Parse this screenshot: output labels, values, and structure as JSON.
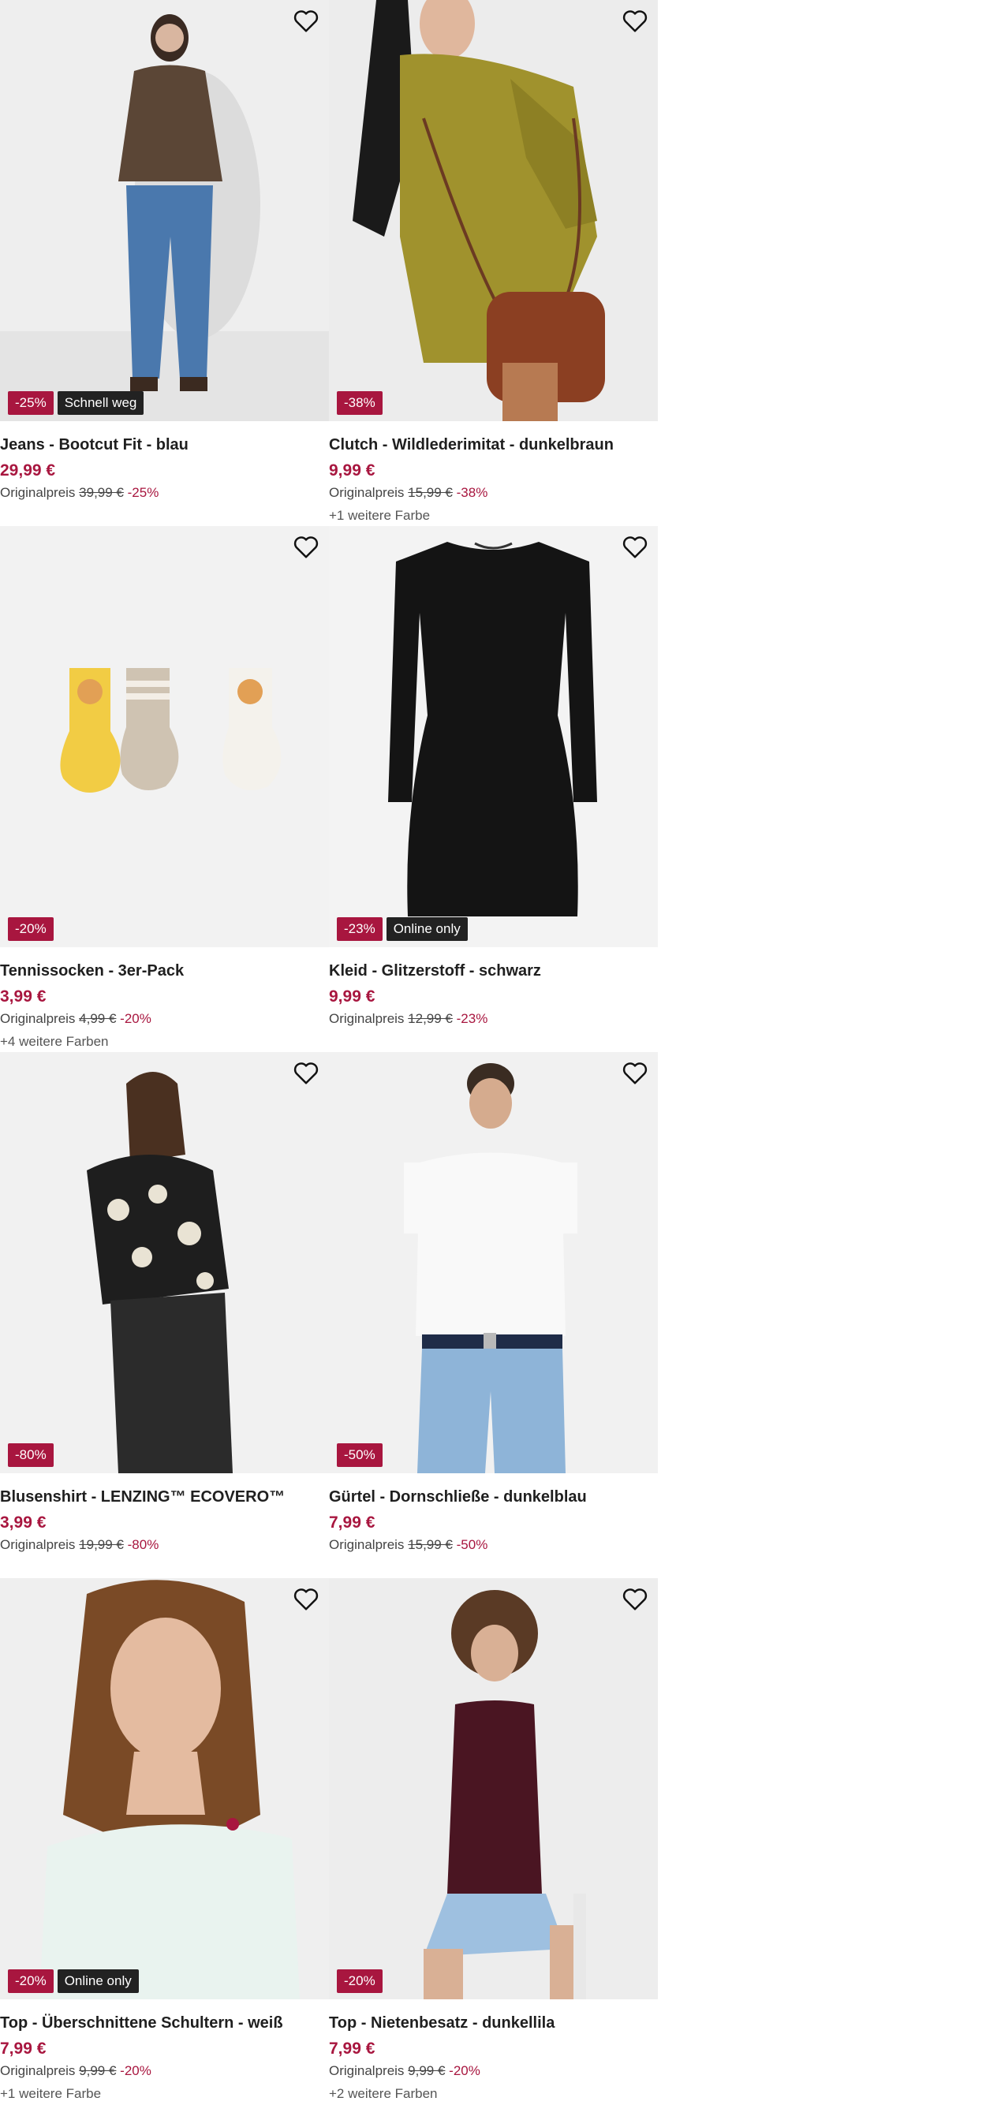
{
  "colors": {
    "accent": "#a8163f",
    "badge_dark": "#222222"
  },
  "products": [
    {
      "title": "Jeans - Bootcut Fit - blau",
      "price": "29,99 €",
      "orig_label": "Originalpreis",
      "orig_price": "39,99 €",
      "orig_pct": "-25%",
      "badges": [
        "-25%",
        "Schnell weg"
      ],
      "colors_note": ""
    },
    {
      "title": "Clutch - Wildlederimitat - dunkelbraun",
      "price": "9,99 €",
      "orig_label": "Originalpreis",
      "orig_price": "15,99 €",
      "orig_pct": "-38%",
      "badges": [
        "-38%"
      ],
      "colors_note": "+1 weitere Farbe"
    },
    {
      "title": "Tennissocken - 3er-Pack",
      "price": "3,99 €",
      "orig_label": "Originalpreis",
      "orig_price": "4,99 €",
      "orig_pct": "-20%",
      "badges": [
        "-20%"
      ],
      "colors_note": "+4 weitere Farben"
    },
    {
      "title": "Kleid - Glitzerstoff - schwarz",
      "price": "9,99 €",
      "orig_label": "Originalpreis",
      "orig_price": "12,99 €",
      "orig_pct": "-23%",
      "badges": [
        "-23%",
        "Online only"
      ],
      "colors_note": ""
    },
    {
      "title": "Blusenshirt - LENZING™ ECOVERO™",
      "price": "3,99 €",
      "orig_label": "Originalpreis",
      "orig_price": "19,99 €",
      "orig_pct": "-80%",
      "badges": [
        "-80%"
      ],
      "colors_note": ""
    },
    {
      "title": "Gürtel - Dornschließe - dunkelblau",
      "price": "7,99 €",
      "orig_label": "Originalpreis",
      "orig_price": "15,99 €",
      "orig_pct": "-50%",
      "badges": [
        "-50%"
      ],
      "colors_note": ""
    },
    {
      "title": "Top - Überschnittene Schultern - weiß",
      "price": "7,99 €",
      "orig_label": "Originalpreis",
      "orig_price": "9,99 €",
      "orig_pct": "-20%",
      "badges": [
        "-20%",
        "Online only"
      ],
      "colors_note": "+1 weitere Farbe"
    },
    {
      "title": "Top - Nietenbesatz - dunkellila",
      "price": "7,99 €",
      "orig_label": "Originalpreis",
      "orig_price": "9,99 €",
      "orig_pct": "-20%",
      "badges": [
        "-20%"
      ],
      "colors_note": "+2 weitere Farben"
    }
  ]
}
